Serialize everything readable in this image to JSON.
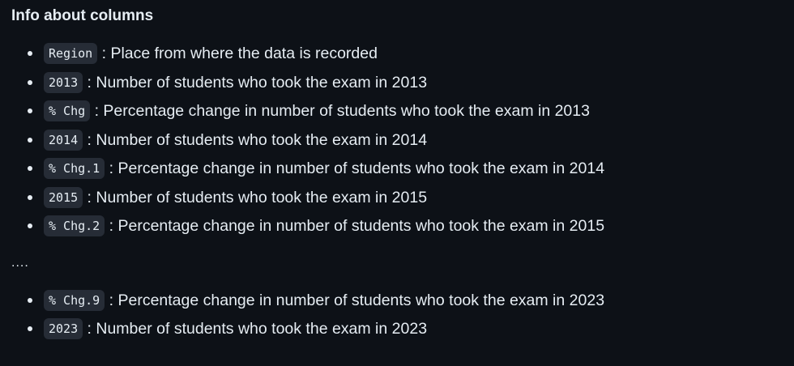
{
  "doc": {
    "heading": "Info about columns",
    "columns_first": [
      {
        "code": "Region",
        "desc": ": Place from where the data is recorded"
      },
      {
        "code": "2013",
        "desc": ": Number of students who took the exam in 2013"
      },
      {
        "code": "% Chg",
        "desc": ": Percentage change in number of students who took the exam in 2013"
      },
      {
        "code": "2014",
        "desc": ": Number of students who took the exam in 2014"
      },
      {
        "code": "% Chg.1",
        "desc": ": Percentage change in number of students who took the exam in 2014"
      },
      {
        "code": "2015",
        "desc": ": Number of students who took the exam in 2015"
      },
      {
        "code": "% Chg.2",
        "desc": ": Percentage change in number of students who took the exam in 2015"
      }
    ],
    "ellipsis": "....",
    "columns_last": [
      {
        "code": "% Chg.9",
        "desc": ": Percentage change in number of students who took the exam in 2023"
      },
      {
        "code": "2023",
        "desc": ": Number of students who took the exam in 2023"
      }
    ]
  }
}
